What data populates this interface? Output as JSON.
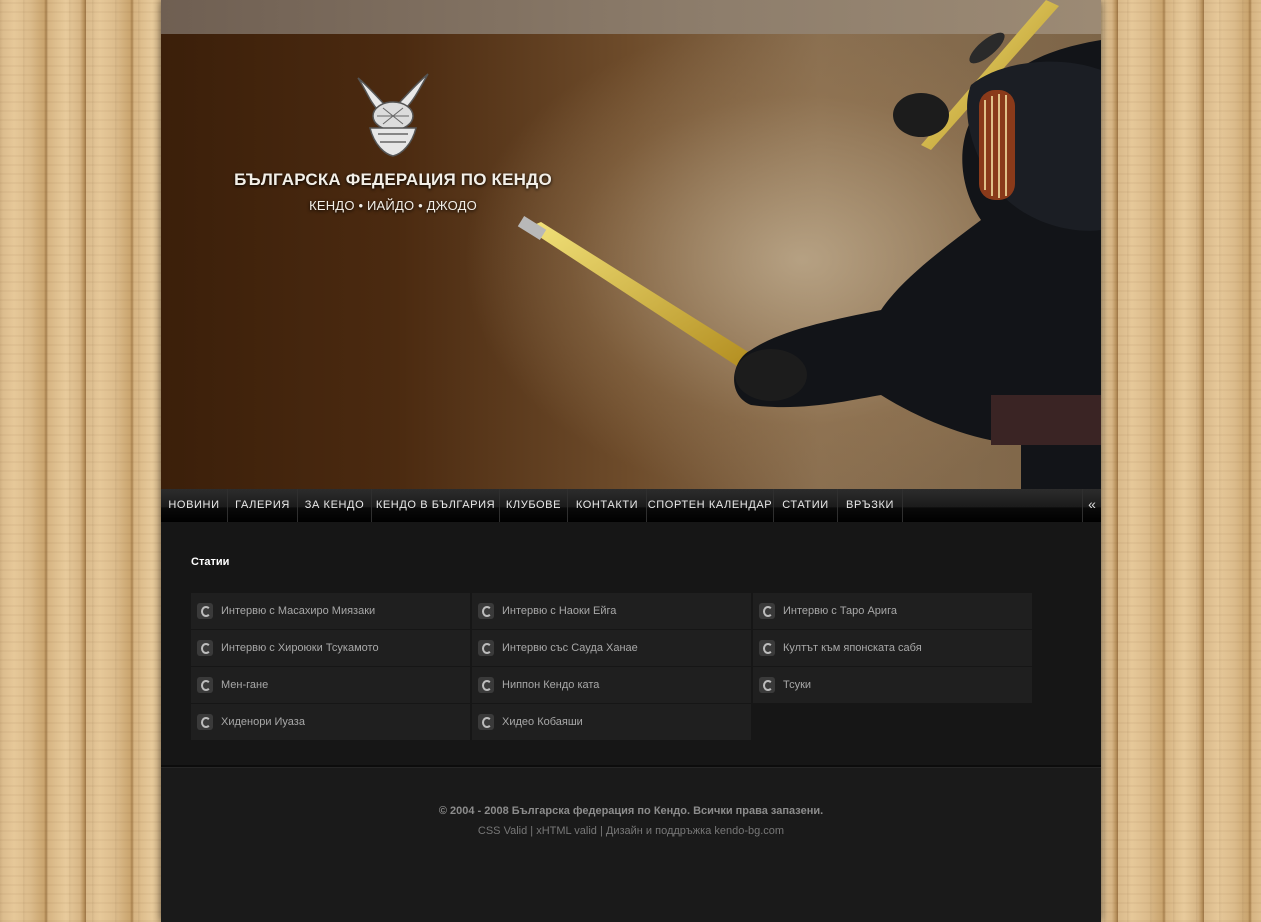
{
  "header": {
    "title": "БЪЛГАРСКА ФЕДЕРАЦИЯ ПО КЕНДО",
    "subtitle": "КЕНДО • ИАЙДО • ДЖОДО"
  },
  "nav": {
    "items": [
      "НОВИНИ",
      "ГАЛЕРИЯ",
      "ЗА КЕНДО",
      "КЕНДО В БЪЛГАРИЯ",
      "КЛУБОВЕ",
      "КОНТАКТИ",
      "СПОРТЕН КАЛЕНДАР",
      "СТАТИИ",
      "ВРЪЗКИ"
    ],
    "toggle": "«"
  },
  "main": {
    "title": "Статии",
    "articles": [
      "Интервю с Масахиро Миязаки",
      "Интервю с Наоки Ейга",
      "Интервю с Таро Арига",
      "Интервю с Хироюки Тсукамото",
      "Интервю със Саудa Ханае",
      "Култът към японската сабя",
      "Мен-гане",
      "Ниппон Кендо ката",
      "Тсуки",
      "Хиденори Иуаза",
      "Хидео Кобаяши"
    ]
  },
  "footer": {
    "copyright": "© 2004 - 2008 Българска федерация по Кендо. Всички права запазени.",
    "css": "CSS Valid",
    "xhtml": "xHTML valid",
    "design": "Дизайн и поддръжка kendo-bg.com",
    "sep": " | "
  }
}
